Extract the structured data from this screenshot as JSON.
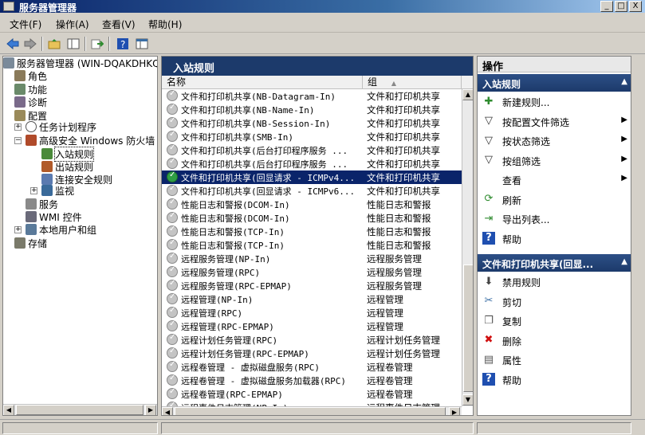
{
  "window": {
    "title": "服务器管理器"
  },
  "window_controls": [
    "_",
    "□",
    "X"
  ],
  "menu": [
    "文件(F)",
    "操作(A)",
    "查看(V)",
    "帮助(H)"
  ],
  "toolbar": {
    "buttons": [
      "back-icon",
      "forward-icon",
      "up-folder-icon",
      "show-hide-tree-icon",
      "export-icon",
      "help-icon",
      "properties-icon"
    ]
  },
  "tree": {
    "root": "服务器管理器 (WIN-DQAKDHKQ1OD)",
    "roles": "角色",
    "features": "功能",
    "diagnostics": "诊断",
    "config": "配置",
    "task_scheduler": "任务计划程序",
    "firewall": "高级安全 Windows 防火墙",
    "inbound": "入站规则",
    "outbound": "出站规则",
    "conn_security": "连接安全规则",
    "monitoring": "监视",
    "services": "服务",
    "wmi": "WMI 控件",
    "local_users": "本地用户和组",
    "storage": "存储"
  },
  "center": {
    "title": "入站规则",
    "columns": {
      "name": "名称",
      "group": "组"
    },
    "rows": [
      {
        "name": "文件和打印机共享(NB-Datagram-In)",
        "group": "文件和打印机共享",
        "enabled": false
      },
      {
        "name": "文件和打印机共享(NB-Name-In)",
        "group": "文件和打印机共享",
        "enabled": false
      },
      {
        "name": "文件和打印机共享(NB-Session-In)",
        "group": "文件和打印机共享",
        "enabled": false
      },
      {
        "name": "文件和打印机共享(SMB-In)",
        "group": "文件和打印机共享",
        "enabled": false
      },
      {
        "name": "文件和打印机共享(后台打印程序服务 ...",
        "group": "文件和打印机共享",
        "enabled": false
      },
      {
        "name": "文件和打印机共享(后台打印程序服务 ...",
        "group": "文件和打印机共享",
        "enabled": false
      },
      {
        "name": "文件和打印机共享(回显请求 - ICMPv4...",
        "group": "文件和打印机共享",
        "enabled": true,
        "selected": true
      },
      {
        "name": "文件和打印机共享(回显请求 - ICMPv6...",
        "group": "文件和打印机共享",
        "enabled": false
      },
      {
        "name": "性能日志和警报(DCOM-In)",
        "group": "性能日志和警报",
        "enabled": false
      },
      {
        "name": "性能日志和警报(DCOM-In)",
        "group": "性能日志和警报",
        "enabled": false
      },
      {
        "name": "性能日志和警报(TCP-In)",
        "group": "性能日志和警报",
        "enabled": false
      },
      {
        "name": "性能日志和警报(TCP-In)",
        "group": "性能日志和警报",
        "enabled": false
      },
      {
        "name": "远程服务管理(NP-In)",
        "group": "远程服务管理",
        "enabled": false
      },
      {
        "name": "远程服务管理(RPC)",
        "group": "远程服务管理",
        "enabled": false
      },
      {
        "name": "远程服务管理(RPC-EPMAP)",
        "group": "远程服务管理",
        "enabled": false
      },
      {
        "name": "远程管理(NP-In)",
        "group": "远程管理",
        "enabled": false
      },
      {
        "name": "远程管理(RPC)",
        "group": "远程管理",
        "enabled": false
      },
      {
        "name": "远程管理(RPC-EPMAP)",
        "group": "远程管理",
        "enabled": false
      },
      {
        "name": "远程计划任务管理(RPC)",
        "group": "远程计划任务管理",
        "enabled": false
      },
      {
        "name": "远程计划任务管理(RPC-EPMAP)",
        "group": "远程计划任务管理",
        "enabled": false
      },
      {
        "name": "远程卷管理 - 虚拟磁盘服务(RPC)",
        "group": "远程卷管理",
        "enabled": false
      },
      {
        "name": "远程卷管理 - 虚拟磁盘服务加载器(RPC)",
        "group": "远程卷管理",
        "enabled": false
      },
      {
        "name": "远程卷管理(RPC-EPMAP)",
        "group": "远程卷管理",
        "enabled": false
      },
      {
        "name": "远程事件日志管理(NP-In)",
        "group": "远程事件日志管理",
        "enabled": false
      }
    ]
  },
  "actions": {
    "header": "操作",
    "section1": {
      "title": "入站规则",
      "items": [
        {
          "label": "新建规则...",
          "icon": "new-rule-icon"
        },
        {
          "label": "按配置文件筛选",
          "icon": "filter-icon",
          "submenu": true
        },
        {
          "label": "按状态筛选",
          "icon": "filter-icon",
          "submenu": true
        },
        {
          "label": "按组筛选",
          "icon": "filter-icon",
          "submenu": true
        },
        {
          "label": "查看",
          "icon": "",
          "submenu": true
        },
        {
          "label": "刷新",
          "icon": "refresh-icon"
        },
        {
          "label": "导出列表...",
          "icon": "export-icon"
        },
        {
          "label": "帮助",
          "icon": "help-icon"
        }
      ]
    },
    "section2": {
      "title": "文件和打印机共享(回显...",
      "items": [
        {
          "label": "禁用规则",
          "icon": "disable-rule-icon"
        },
        {
          "label": "剪切",
          "icon": "cut-icon"
        },
        {
          "label": "复制",
          "icon": "copy-icon"
        },
        {
          "label": "删除",
          "icon": "delete-icon"
        },
        {
          "label": "属性",
          "icon": "properties-icon"
        },
        {
          "label": "帮助",
          "icon": "help-icon"
        }
      ]
    }
  }
}
